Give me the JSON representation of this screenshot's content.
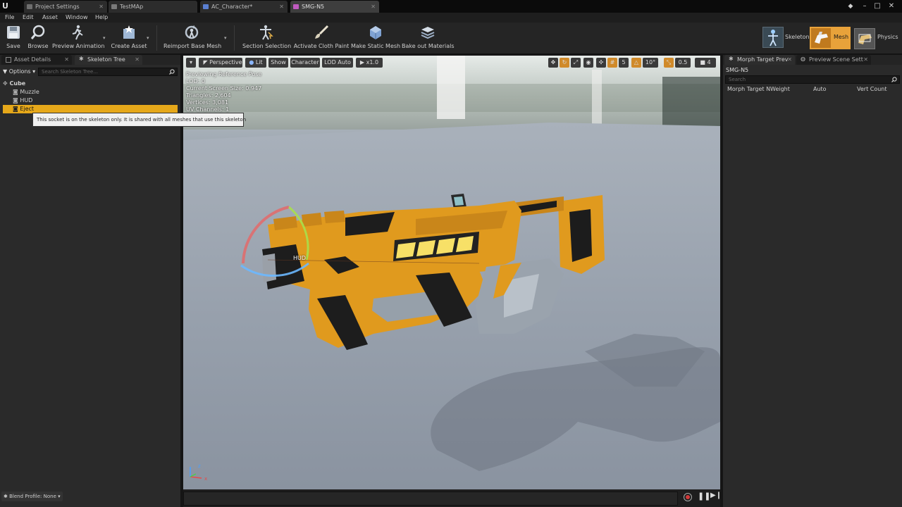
{
  "tabs": [
    {
      "label": "Project Settings",
      "color": "#6e6e6e"
    },
    {
      "label": "TestMAp",
      "color": "#7a7a7a"
    },
    {
      "label": "AC_Character*",
      "color": "#5a7fd1"
    },
    {
      "label": "SMG-N5",
      "color": "#c05ac0"
    }
  ],
  "menu": [
    "File",
    "Edit",
    "Asset",
    "Window",
    "Help"
  ],
  "toolbar": {
    "save": "Save",
    "browse": "Browse",
    "preview_animation": "Preview Animation",
    "create_asset": "Create Asset",
    "reimport": "Reimport Base Mesh",
    "section_selection": "Section Selection",
    "activate_cloth": "Activate Cloth Paint",
    "make_static": "Make Static Mesh",
    "bake_out": "Bake out Materials"
  },
  "modes": {
    "skeleton": "Skeleton",
    "mesh": "Mesh",
    "physics": "Physics",
    "accent": "#e8a23a"
  },
  "left_panel": {
    "tab_asset_details": "Asset Details",
    "tab_skeleton_tree": "Skeleton Tree",
    "options": "Options",
    "search_placeholder": "Search Skeleton Tree...",
    "tree": [
      {
        "label": "Cube",
        "depth": 0
      },
      {
        "label": "Muzzle",
        "depth": 1
      },
      {
        "label": "HUD",
        "depth": 1
      },
      {
        "label": "Eject",
        "depth": 1,
        "selected": true
      }
    ],
    "tooltip": "This socket is on the skeleton only.  It is shared with all meshes that use this skeleton",
    "blend_profile": "Blend Profile: None"
  },
  "viewport": {
    "perspective": "Perspective",
    "lit": "Lit",
    "show": "Show",
    "character": "Character",
    "lod": "LOD Auto",
    "speed": "x1.0",
    "grid_value": "5",
    "angle_value": "10°",
    "scale_value": "0.5",
    "camera_speed": "4",
    "info": [
      "Previewing Reference Pose",
      "LOD: 0",
      "Current Screen Size: 0.947",
      "Triangles: 2,604",
      "Vertices: 3,081",
      "UV Channels: 1"
    ],
    "socket_label": "HUD",
    "weapon_color": "#e09a1e"
  },
  "right_panel": {
    "tab_morph": "Morph Target Prev",
    "tab_preview": "Preview Scene Sett",
    "asset_name": "SMG-N5",
    "search_placeholder": "Search",
    "columns": [
      "Morph Target N",
      "Weight",
      "Auto",
      "Vert Count"
    ]
  }
}
